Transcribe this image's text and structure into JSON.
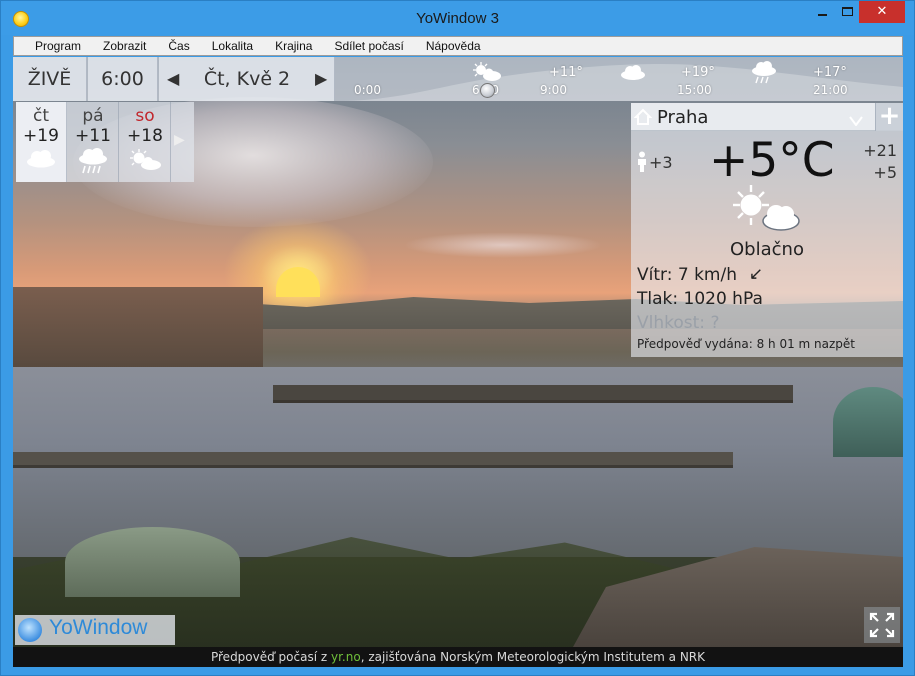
{
  "window": {
    "title": "YoWindow 3",
    "close_label": "✕"
  },
  "menu": {
    "items": [
      "Program",
      "Zobrazit",
      "Čas",
      "Lokalita",
      "Krajina",
      "Sdílet počasí",
      "Nápověda"
    ]
  },
  "topbar": {
    "live_label": "ŽIVĚ",
    "time": "6:00",
    "date": "Čt, Kvě 2",
    "timeline": {
      "temps": [
        "+11°",
        "+19°",
        "+17°"
      ],
      "hours": [
        "0:00",
        "6:00",
        "9:00",
        "15:00",
        "21:00"
      ],
      "icons": [
        "sun-cloud-icon",
        "cloud-icon",
        "rain-cloud-icon"
      ]
    }
  },
  "forecast": {
    "days": [
      {
        "name": "čt",
        "temp": "+19",
        "icon": "cloud-icon",
        "weekend": false
      },
      {
        "name": "pá",
        "temp": "+11",
        "icon": "rain-cloud-icon",
        "weekend": false
      },
      {
        "name": "so",
        "temp": "+18",
        "icon": "sun-cloud-icon",
        "weekend": true
      }
    ]
  },
  "panel": {
    "city": "Praha",
    "feels_like": "+3",
    "temperature": "+5°C",
    "high": "+21",
    "low": "+5",
    "condition": "Oblačno",
    "wind_label": "Vítr:",
    "wind_value": "7 km/h",
    "pressure_label": "Tlak:",
    "pressure_value": "1020 hPa",
    "humidity_label": "Vlhkost:",
    "humidity_value": "?",
    "forecast_label": "Předpověď vydána:",
    "forecast_value": "8 h 01 m nazpět"
  },
  "brand": {
    "name": "YoWindow"
  },
  "status": {
    "prefix": "Předpověď počasí z ",
    "source": "yr.no",
    "suffix": ", zajišťována Norským Meteorologickým Institutem a NRK"
  },
  "colors": {
    "accent": "#3c9ce7",
    "close": "#c8302c",
    "weekend": "#c1272d",
    "link": "#6fbf3a",
    "brand": "#2e8ad8"
  }
}
